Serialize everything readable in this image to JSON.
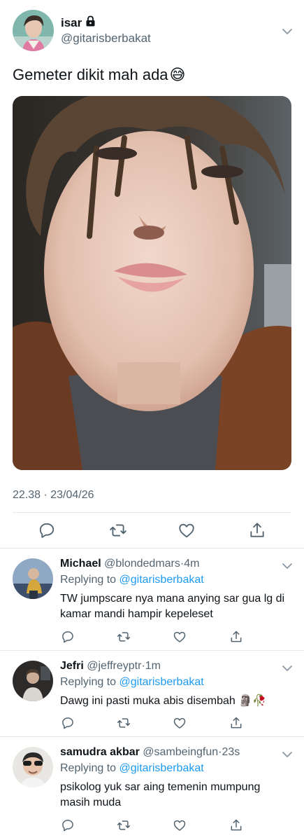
{
  "tweet": {
    "display_name": "isar",
    "handle": "@gitarisberbakat",
    "text": "Gemeter dikit mah ada",
    "emoji": "😅",
    "timestamp": "22.38 · 23/04/26"
  },
  "replies": [
    {
      "name": "Michael",
      "handle": "@blondedmars",
      "age": "4m",
      "replying_prefix": "Replying to",
      "mention": "@gitarisberbakat",
      "text": "TW jumpscare nya mana anying sar gua lg di kamar mandi hampir kepeleset"
    },
    {
      "name": "Jefri",
      "handle": "@jeffreyptr",
      "age": "1m",
      "replying_prefix": "Replying to",
      "mention": "@gitarisberbakat",
      "text": "Dawg ini pasti muka abis disembah 🗿🥀"
    },
    {
      "name": "samudra akbar",
      "handle": "@sambeingfun",
      "age": "23s",
      "replying_prefix": "Replying to",
      "mention": "@gitarisberbakat",
      "text": "psikolog yuk sar aing temenin mumpung masih muda"
    }
  ],
  "colors": {
    "text": "#0f1419",
    "secondary": "#536471",
    "link": "#1d9bf0",
    "divider": "#e6e9eb"
  },
  "icons": [
    "lock-icon",
    "chevron-down-icon",
    "reply-icon",
    "retweet-icon",
    "like-icon",
    "share-icon"
  ]
}
